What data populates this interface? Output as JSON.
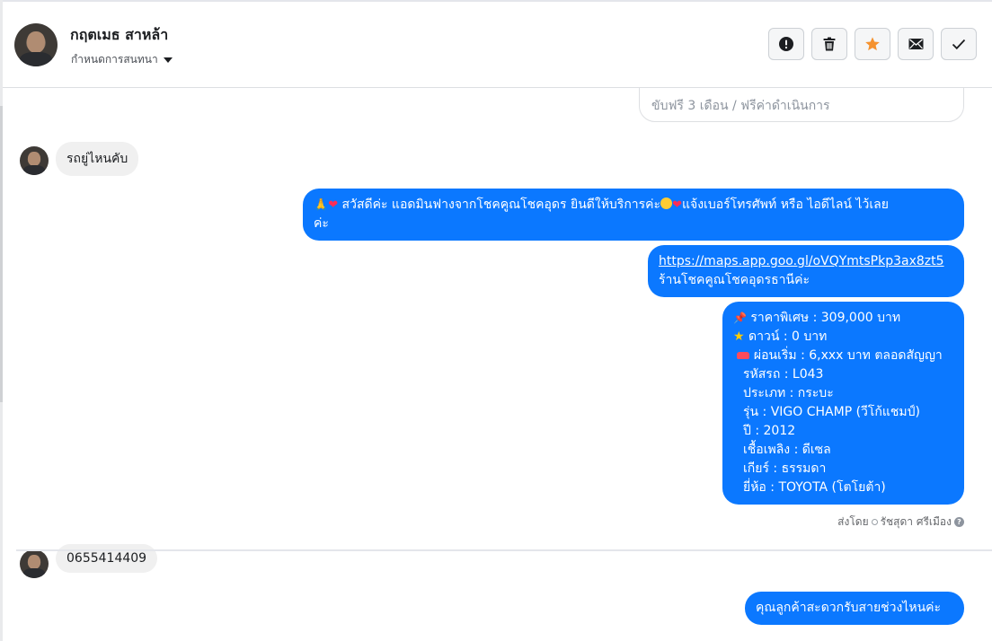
{
  "header": {
    "contact_name": "กฤตเมธ สาหล้า",
    "assign_label": "กำหนดการสนทนา",
    "actions": [
      {
        "name": "spam",
        "icon": "exclamation-circle-icon"
      },
      {
        "name": "delete",
        "icon": "trash-icon"
      },
      {
        "name": "star",
        "icon": "star-icon"
      },
      {
        "name": "mark-unread",
        "icon": "envelope-icon"
      },
      {
        "name": "done",
        "icon": "check-icon"
      }
    ],
    "star_color": "#f5922f"
  },
  "messages": {
    "partial_top": "ขับฟรี 3 เดือน / ฟรีค่าดำเนินการ",
    "incoming_1": "รถยู่ไหนคับ",
    "outgoing_1": {
      "line1": " สวัสดีค่ะ แอดมินฟางจากโชคคูณโชคอุดร ยินดีให้บริการค่ะ",
      "line1b": "แจ้งเบอร์โทรศัพท์ หรือ ไอดีไลน์  ไว้เลย",
      "line2": "ค่ะ"
    },
    "outgoing_2": {
      "link": "https://maps.app.goo.gl/oVQYmtsPkp3ax8zt5",
      "text": "ร้านโชคคูณโชคอุดรธานีค่ะ"
    },
    "outgoing_3": [
      " ราคาพิเศษ : 309,000 บาท",
      " ดาวน์ : 0 บาท",
      " ผ่อนเริ่ม : 6,xxx บาท ตลอดสัญญา",
      "รหัสรถ : L043",
      "ประเภท : กระบะ",
      "รุ่น : VIGO CHAMP (วีโก้แชมป์)",
      "ปี : 2012",
      "เชื้อเพลิง : ดีเซล",
      "เกียร์ : ธรรมดา",
      "ยี่ห้อ : TOYOTA (โตโยต้า)"
    ],
    "sent_by_label": "ส่งโดย",
    "sent_by_name": "รัชสุดา ศรีเมือง",
    "incoming_2": "0655414409",
    "outgoing_4": "คุณลูกค้าสะดวกรับสายช่วงไหนค่ะ"
  },
  "colors": {
    "outgoing_bubble": "#0b78ff",
    "incoming_bubble": "#f0f0f0"
  }
}
